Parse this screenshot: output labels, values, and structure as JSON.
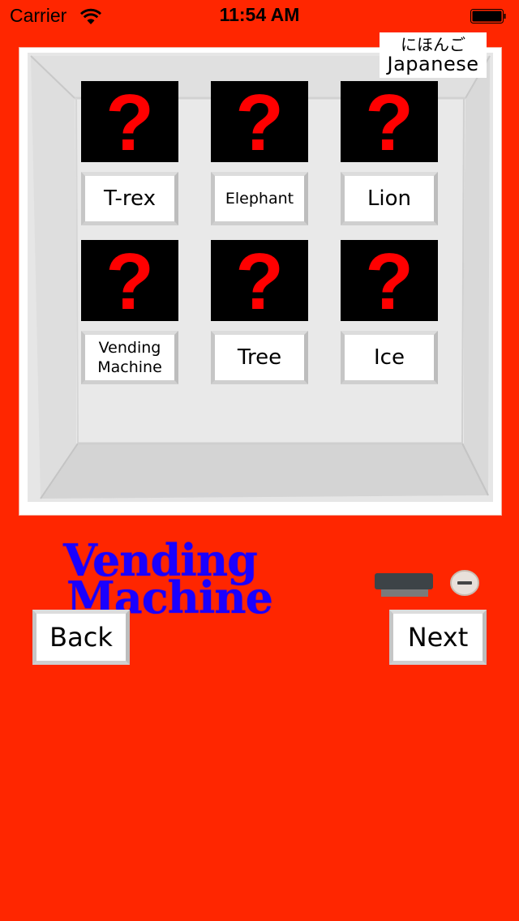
{
  "status_bar": {
    "carrier": "Carrier",
    "time": "11:54 AM",
    "wifi_icon": "wifi-icon",
    "battery_icon": "battery-icon"
  },
  "language_button": {
    "japanese_label": "にほんご",
    "english_label": "Japanese"
  },
  "items": [
    {
      "label": "T-rex",
      "image": "?",
      "size": "fs-big"
    },
    {
      "label": "Elephant",
      "image": "?",
      "size": "fs-small"
    },
    {
      "label": "Lion",
      "image": "?",
      "size": "fs-big"
    },
    {
      "label": "Vending\nMachine",
      "image": "?",
      "size": "fs-two"
    },
    {
      "label": "Tree",
      "image": "?",
      "size": "fs-big"
    },
    {
      "label": "Ice",
      "image": "?",
      "size": "fs-big"
    }
  ],
  "logo": {
    "line1": "Vending",
    "line2": "Machine"
  },
  "navigation": {
    "back_label": "Back",
    "next_label": "Next"
  },
  "colors": {
    "background": "#ff2600",
    "logo": "#1a00ff",
    "question_mark": "#ff0000",
    "tile": "#000000"
  }
}
